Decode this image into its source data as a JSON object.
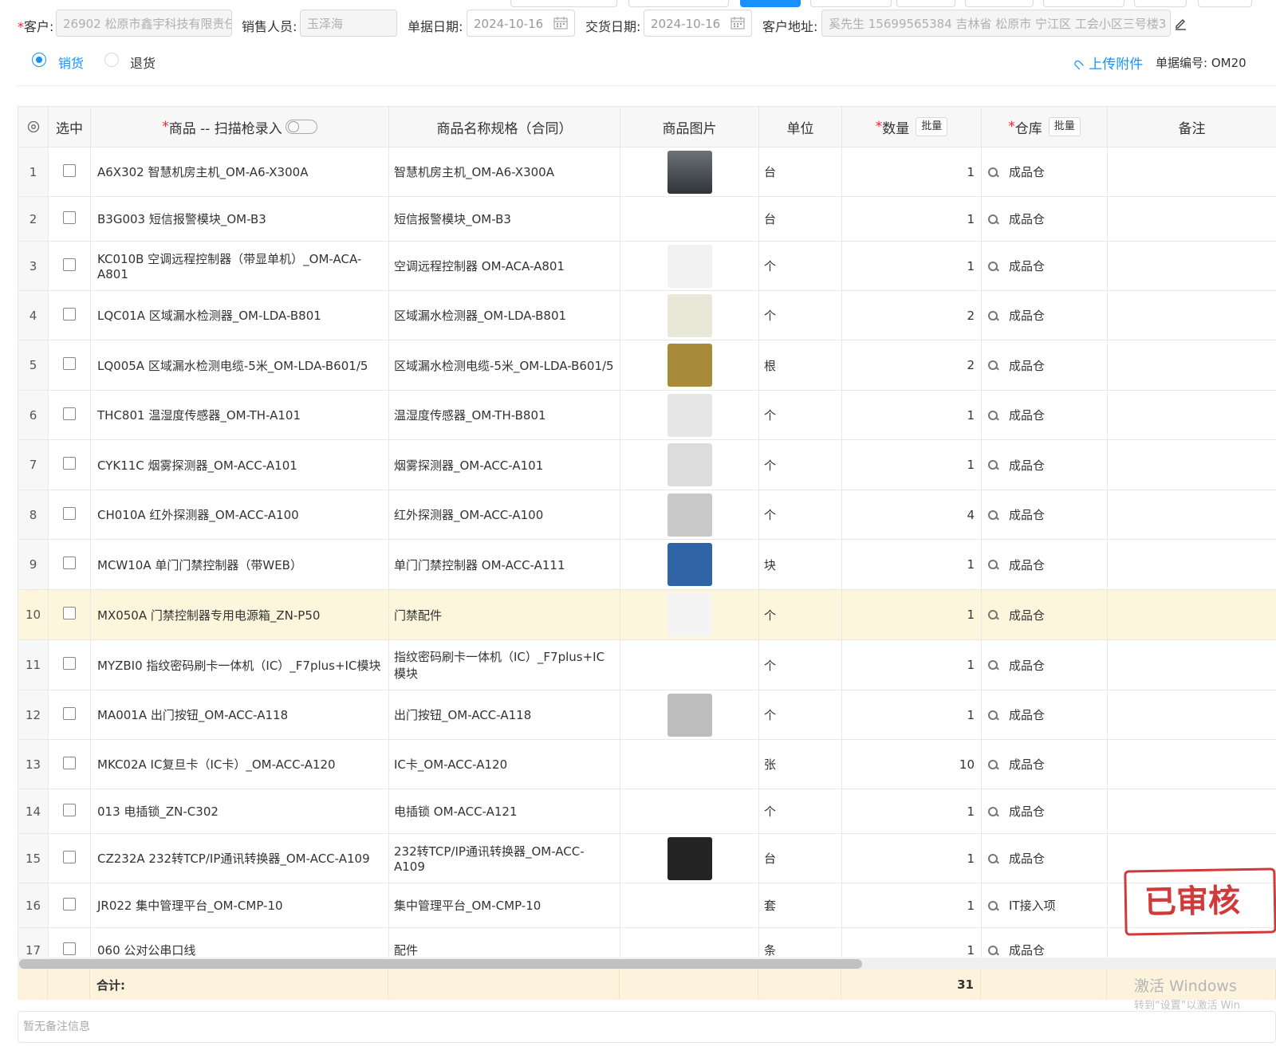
{
  "form": {
    "customer_label": "客户:",
    "customer_value": "26902 松原市鑫宇科技有限责任",
    "salesperson_label": "销售人员:",
    "salesperson_value": "玉泽海",
    "bill_date_label": "单据日期:",
    "bill_date_value": "2024-10-16",
    "delivery_date_label": "交货日期:",
    "delivery_date_value": "2024-10-16",
    "address_label": "客户地址:",
    "address_value": "奚先生 15699565384 吉林省 松原市 宁江区 工会小区三号楼3"
  },
  "type_radio": {
    "sale_label": "销货",
    "return_label": "退货",
    "selected": "sale"
  },
  "upload_label": "上传附件",
  "bill_no_label": "单据编号: OM20",
  "table": {
    "headers": {
      "select": "选中",
      "product": "商品 -- 扫描枪录入",
      "name_spec": "商品名称规格（合同）",
      "image": "商品图片",
      "unit": "单位",
      "qty": "数量",
      "warehouse": "仓库",
      "note": "备注",
      "batch": "批量"
    },
    "rows": [
      {
        "idx": "1",
        "product": "A6X302 智慧机房主机_OM-A6-X300A",
        "name": "智慧机房主机_OM-A6-X300A",
        "img": "server-cabinet",
        "unit": "台",
        "qty": "1",
        "wh": "成品仓"
      },
      {
        "idx": "2",
        "product": "B3G003 短信报警模块_OM-B3",
        "name": "短信报警模块_OM-B3",
        "img": "",
        "unit": "台",
        "qty": "1",
        "wh": "成品仓"
      },
      {
        "idx": "3",
        "product": "KC010B 空调远程控制器（带显单机）_OM-ACA-A801",
        "name": "空调远程控制器 OM-ACA-A801",
        "img": "ac-controller",
        "unit": "个",
        "qty": "1",
        "wh": "成品仓"
      },
      {
        "idx": "4",
        "product": "LQC01A 区域漏水检测器_OM-LDA-B801",
        "name": "区域漏水检测器_OM-LDA-B801",
        "img": "leak-detector",
        "unit": "个",
        "qty": "2",
        "wh": "成品仓"
      },
      {
        "idx": "5",
        "product": "LQ005A 区域漏水检测电缆-5米_OM-LDA-B601/5",
        "name": "区域漏水检测电缆-5米_OM-LDA-B601/5",
        "img": "leak-cable",
        "unit": "根",
        "qty": "2",
        "wh": "成品仓"
      },
      {
        "idx": "6",
        "product": "THC801 温湿度传感器_OM-TH-A101",
        "name": "温湿度传感器_OM-TH-B801",
        "img": "th-sensor",
        "unit": "个",
        "qty": "1",
        "wh": "成品仓"
      },
      {
        "idx": "7",
        "product": "CYK11C 烟雾探测器_OM-ACC-A101",
        "name": "烟雾探测器_OM-ACC-A101",
        "img": "smoke-detector",
        "unit": "个",
        "qty": "1",
        "wh": "成品仓"
      },
      {
        "idx": "8",
        "product": "CH010A 红外探测器_OM-ACC-A100",
        "name": "红外探测器_OM-ACC-A100",
        "img": "pir-detector",
        "unit": "个",
        "qty": "4",
        "wh": "成品仓"
      },
      {
        "idx": "9",
        "product": "MCW10A 单门门禁控制器（带WEB）",
        "name": "单门门禁控制器 OM-ACC-A111",
        "img": "access-board",
        "unit": "块",
        "qty": "1",
        "wh": "成品仓"
      },
      {
        "idx": "10",
        "product": "MX050A 门禁控制器专用电源箱_ZN-P50",
        "name": "门禁配件",
        "img": "power-box",
        "unit": "个",
        "qty": "1",
        "wh": "成品仓",
        "highlight": true
      },
      {
        "idx": "11",
        "product": "MYZBI0 指纹密码刷卡一体机（IC）_F7plus+IC模块",
        "name": "指纹密码刷卡一体机（IC）_F7plus+IC模块",
        "img": "fingerprint-reader",
        "unit": "个",
        "qty": "1",
        "wh": "成品仓"
      },
      {
        "idx": "12",
        "product": "MA001A 出门按钮_OM-ACC-A118",
        "name": "出门按钮_OM-ACC-A118",
        "img": "exit-button",
        "unit": "个",
        "qty": "1",
        "wh": "成品仓"
      },
      {
        "idx": "13",
        "product": "MKC02A IC复旦卡（IC卡）_OM-ACC-A120",
        "name": "IC卡_OM-ACC-A120",
        "img": "ic-cards",
        "unit": "张",
        "qty": "10",
        "wh": "成品仓"
      },
      {
        "idx": "14",
        "product": "013 电插锁_ZN-C302",
        "name": "电插锁 OM-ACC-A121",
        "img": "",
        "unit": "个",
        "qty": "1",
        "wh": "成品仓"
      },
      {
        "idx": "15",
        "product": "CZ232A 232转TCP/IP通讯转换器_OM-ACC-A109",
        "name": "232转TCP/IP通讯转换器_OM-ACC-A109",
        "img": "converter",
        "unit": "台",
        "qty": "1",
        "wh": "成品仓"
      },
      {
        "idx": "16",
        "product": "JR022 集中管理平台_OM-CMP-10",
        "name": "集中管理平台_OM-CMP-10",
        "img": "",
        "unit": "套",
        "qty": "1",
        "wh": "IT接入项"
      },
      {
        "idx": "17",
        "product": "060 公对公串口线",
        "name": "配件",
        "img": "",
        "unit": "条",
        "qty": "1",
        "wh": "成品仓"
      }
    ],
    "total_label": "合计:",
    "total_qty": "31"
  },
  "stamp_text": "已审核",
  "watermark": {
    "line1": "激活 Windows",
    "line2": "转到“设置”以激活 Win"
  },
  "remark_placeholder": "暂无备注信息",
  "colors": {
    "accent": "#1890ff",
    "highlight_row": "#fdf6dc",
    "total_row": "#fdf3dd",
    "stamp": "#d03a3a"
  }
}
